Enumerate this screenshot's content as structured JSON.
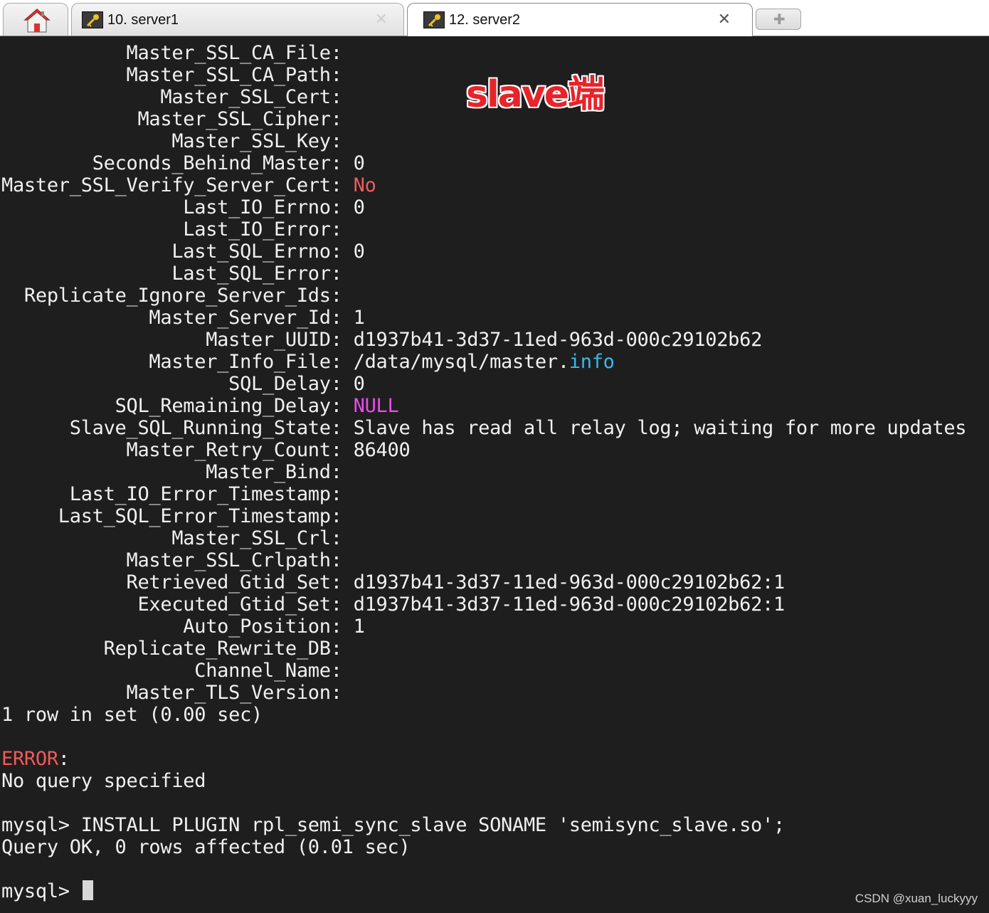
{
  "tabs": [
    {
      "label": "10. server1"
    },
    {
      "label": "12. server2"
    }
  ],
  "annotation": "slave端",
  "status_fields": [
    {
      "key": "Master_SSL_CA_File",
      "value": ""
    },
    {
      "key": "Master_SSL_CA_Path",
      "value": ""
    },
    {
      "key": "Master_SSL_Cert",
      "value": ""
    },
    {
      "key": "Master_SSL_Cipher",
      "value": ""
    },
    {
      "key": "Master_SSL_Key",
      "value": ""
    },
    {
      "key": "Seconds_Behind_Master",
      "value": "0"
    },
    {
      "key": "Master_SSL_Verify_Server_Cert",
      "value": "No",
      "style": "red"
    },
    {
      "key": "Last_IO_Errno",
      "value": "0"
    },
    {
      "key": "Last_IO_Error",
      "value": ""
    },
    {
      "key": "Last_SQL_Errno",
      "value": "0"
    },
    {
      "key": "Last_SQL_Error",
      "value": ""
    },
    {
      "key": "Replicate_Ignore_Server_Ids",
      "value": ""
    },
    {
      "key": "Master_Server_Id",
      "value": "1"
    },
    {
      "key": "Master_UUID",
      "value": "d1937b41-3d37-11ed-963d-000c29102b62"
    },
    {
      "key": "Master_Info_File",
      "value": "/data/mysql/master.",
      "suffix": "info",
      "suffix_style": "cyan"
    },
    {
      "key": "SQL_Delay",
      "value": "0"
    },
    {
      "key": "SQL_Remaining_Delay",
      "value": "NULL",
      "style": "magenta"
    },
    {
      "key": "Slave_SQL_Running_State",
      "value": "Slave has read all relay log; waiting for more updates"
    },
    {
      "key": "Master_Retry_Count",
      "value": "86400"
    },
    {
      "key": "Master_Bind",
      "value": ""
    },
    {
      "key": "Last_IO_Error_Timestamp",
      "value": ""
    },
    {
      "key": "Last_SQL_Error_Timestamp",
      "value": ""
    },
    {
      "key": "Master_SSL_Crl",
      "value": ""
    },
    {
      "key": "Master_SSL_Crlpath",
      "value": ""
    },
    {
      "key": "Retrieved_Gtid_Set",
      "value": "d1937b41-3d37-11ed-963d-000c29102b62:1"
    },
    {
      "key": "Executed_Gtid_Set",
      "value": "d1937b41-3d37-11ed-963d-000c29102b62:1"
    },
    {
      "key": "Auto_Position",
      "value": "1"
    },
    {
      "key": "Replicate_Rewrite_DB",
      "value": ""
    },
    {
      "key": "Channel_Name",
      "value": ""
    },
    {
      "key": "Master_TLS_Version",
      "value": ""
    }
  ],
  "result_summary": "1 row in set (0.00 sec)",
  "error_label": "ERROR",
  "error_colon": ":",
  "error_message": "No query specified",
  "command_line": "mysql> INSTALL PLUGIN rpl_semi_sync_slave SONAME 'semisync_slave.so';",
  "command_result": "Query OK, 0 rows affected (0.01 sec)",
  "prompt": "mysql> ",
  "watermark": "CSDN @xuan_luckyyy",
  "colors": {
    "red": "#ef5b5b",
    "magenta": "#ec4bec",
    "cyan": "#3bb8e8",
    "background": "#1e1e1e"
  }
}
